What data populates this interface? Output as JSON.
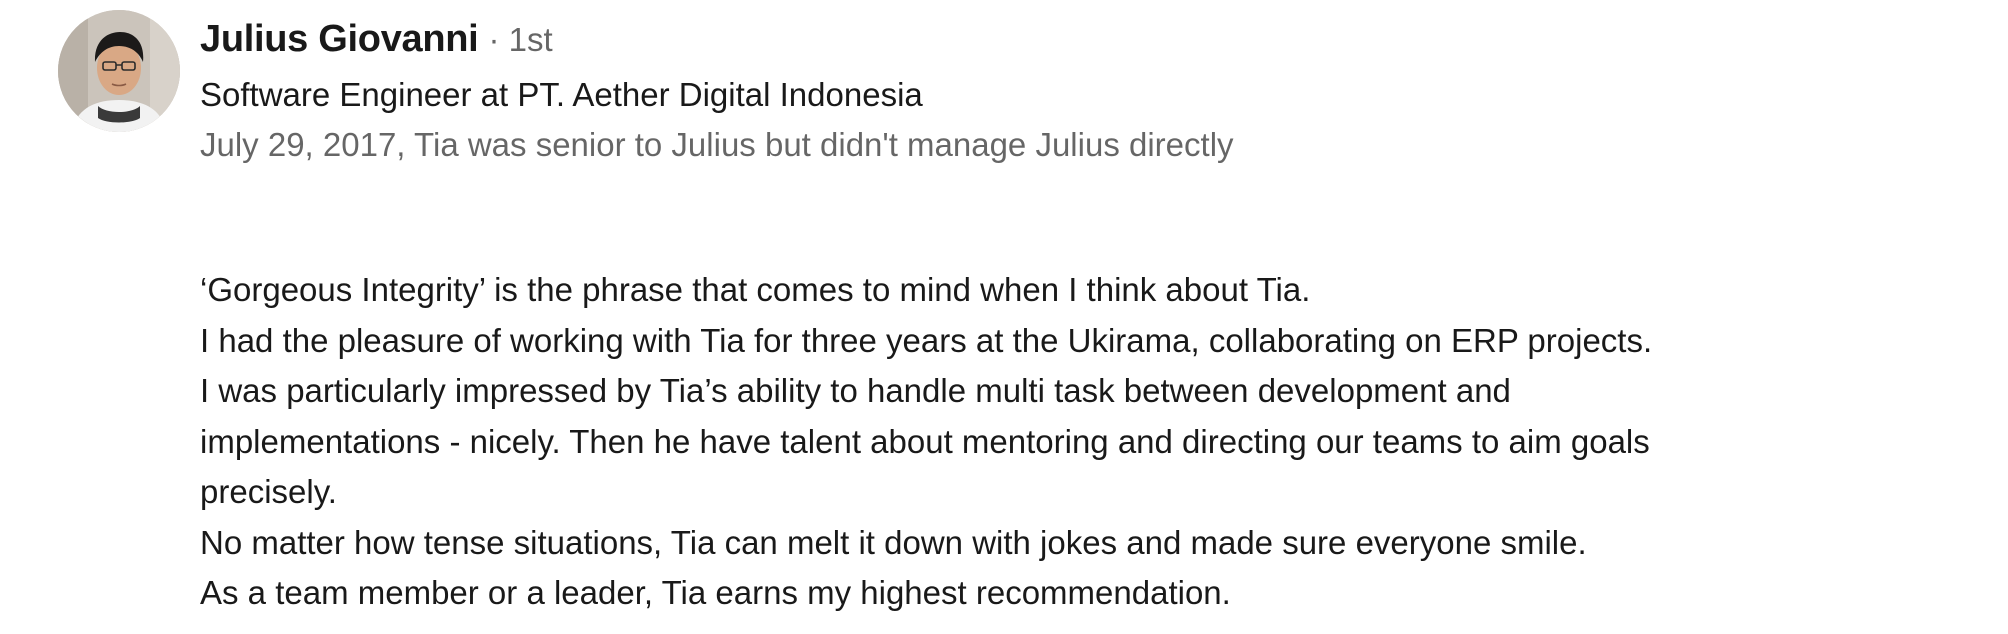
{
  "recommender": {
    "name": "Julius Giovanni",
    "degree": "· 1st",
    "headline": "Software Engineer at PT. Aether Digital Indonesia",
    "meta": "July 29, 2017, Tia was senior to Julius but didn't manage Julius directly"
  },
  "recommendation": {
    "lines": [
      "‘Gorgeous Integrity’ is the phrase that comes to mind when I think about Tia.",
      "I had the pleasure of working with Tia for three years at the Ukirama, collaborating on ERP projects.",
      "I was particularly impressed by Tia’s ability to handle multi task between development and",
      "implementations - nicely. Then he have talent about mentoring and directing our teams to aim goals",
      "precisely.",
      "No matter how tense situations, Tia can melt it down with jokes and made sure everyone smile.",
      "As a team member or a leader, Tia earns my highest recommendation."
    ]
  }
}
